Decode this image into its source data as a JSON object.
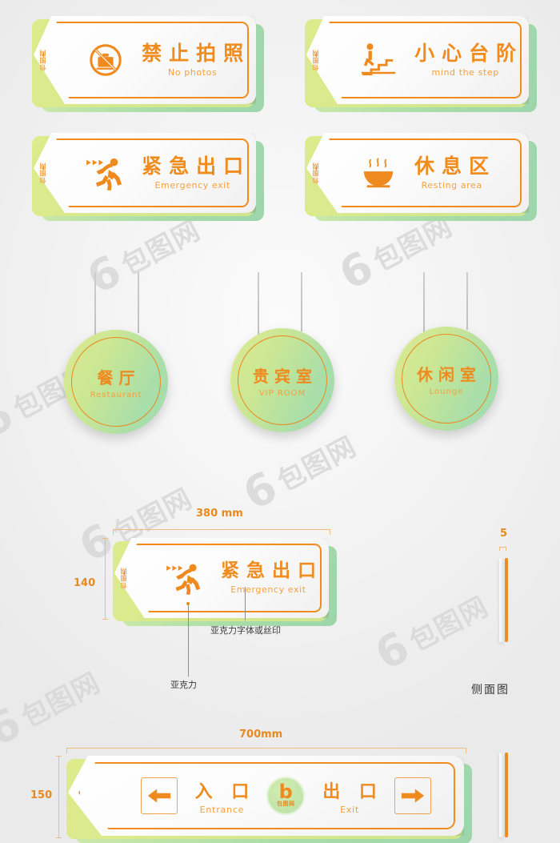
{
  "meta": {
    "background_color": "#f2f2f2",
    "accent_orange": "#ef8a1e",
    "accent_orange_light": "#f4a03c",
    "green_light": "#dcea92",
    "green_dark": "#a0dcae"
  },
  "watermark": {
    "digit": "6",
    "text": "包图网"
  },
  "tab_watermark": "包图网",
  "signs": [
    {
      "cn": "禁止拍照",
      "en": "No photos",
      "icon": "no-camera-icon"
    },
    {
      "cn": "小心台阶",
      "en": "mind the step",
      "icon": "stairs-icon"
    },
    {
      "cn": "紧急出口",
      "en": "Emergency exit",
      "icon": "running-man-icon"
    },
    {
      "cn": "休息区",
      "en": "Resting area",
      "icon": "steaming-bowl-icon"
    }
  ],
  "discs": [
    {
      "cn": "餐厅",
      "en": "Restaurant"
    },
    {
      "cn": "贵宾室",
      "en": "VIP ROOM"
    },
    {
      "cn": "休闲室",
      "en": "Lounge"
    }
  ],
  "spec_small": {
    "width_label": "380 mm",
    "height_label": "140",
    "sign": {
      "cn": "紧急出口",
      "en": "Emergency exit",
      "icon": "running-man-icon"
    },
    "callout_material": "亚克力",
    "callout_text": "亚克力字体或丝印"
  },
  "side_view": {
    "thickness_label": "5",
    "view_label": "侧面图"
  },
  "spec_wide": {
    "width_label": "700mm",
    "height_label": "150",
    "entrance": {
      "cn": "入 口",
      "en": "Entrance",
      "arrow": "arrow-left-icon"
    },
    "exit": {
      "cn": "出 口",
      "en": "Exit",
      "arrow": "arrow-right-icon"
    },
    "logo": {
      "letter": "b",
      "cn": "包图网"
    }
  }
}
